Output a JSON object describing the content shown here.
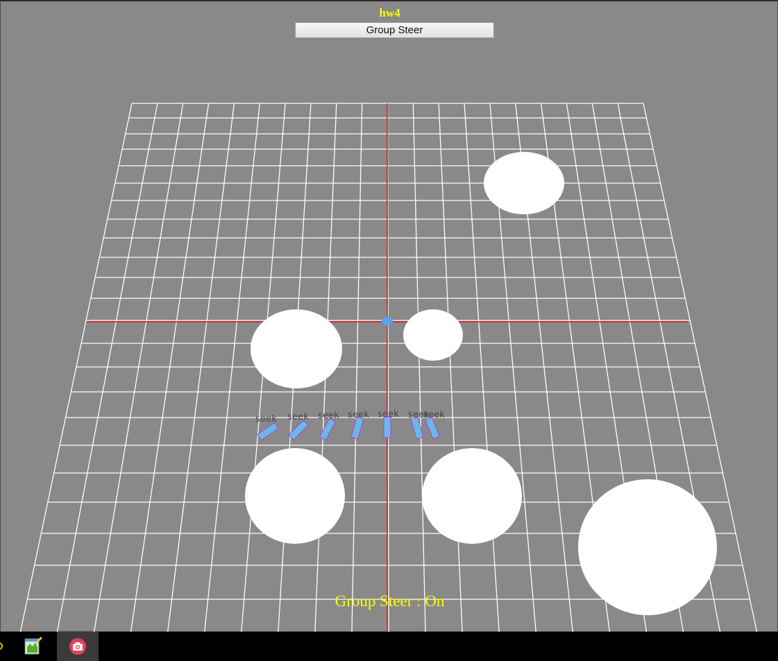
{
  "window": {
    "title": "hw4",
    "title_color": "#ffff00"
  },
  "controls": {
    "mode_button_label": "Group Steer"
  },
  "status": {
    "text": "Group Steer : On",
    "color": "#ffff00"
  },
  "scene": {
    "background": "#898989",
    "grid_color": "#ffffff",
    "axis_color": "#e01010",
    "obstacle_color": "#ffffff",
    "agent_color": "#6ab8e8",
    "agent_edge_color": "#b040d0",
    "target_color": "#5aa0ee",
    "agent_label_color": "#444444",
    "agent_label": "seek",
    "agent_count": 7
  },
  "taskbar": {
    "items": [
      {
        "name": "tray-icon",
        "icon": "partial-circle-icon"
      },
      {
        "name": "notepad-app",
        "icon": "notepad-icon"
      },
      {
        "name": "camera-app",
        "icon": "camera-icon",
        "active": true
      }
    ]
  }
}
